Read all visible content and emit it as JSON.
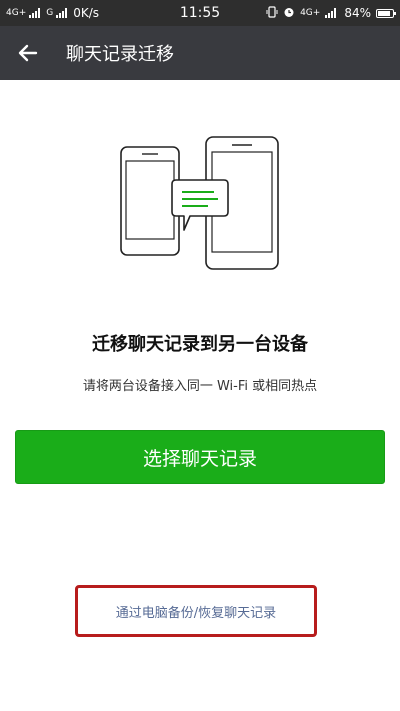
{
  "status_bar": {
    "network1": "4G+",
    "network2": "G",
    "speed": "0K/s",
    "time": "11:55",
    "network3": "4G+",
    "battery": "84%",
    "battery_level": 0.84
  },
  "app_bar": {
    "title": "聊天记录迁移"
  },
  "main": {
    "headline": "迁移聊天记录到另一台设备",
    "subline": "请将两台设备接入同一 Wi-Fi 或相同热点",
    "primary_button": "选择聊天记录",
    "pc_link": "通过电脑备份/恢复聊天记录"
  },
  "colors": {
    "accent_green": "#1aad19",
    "app_bar": "#393a3f",
    "link": "#576b95",
    "annotation_red": "#b71c1c"
  }
}
